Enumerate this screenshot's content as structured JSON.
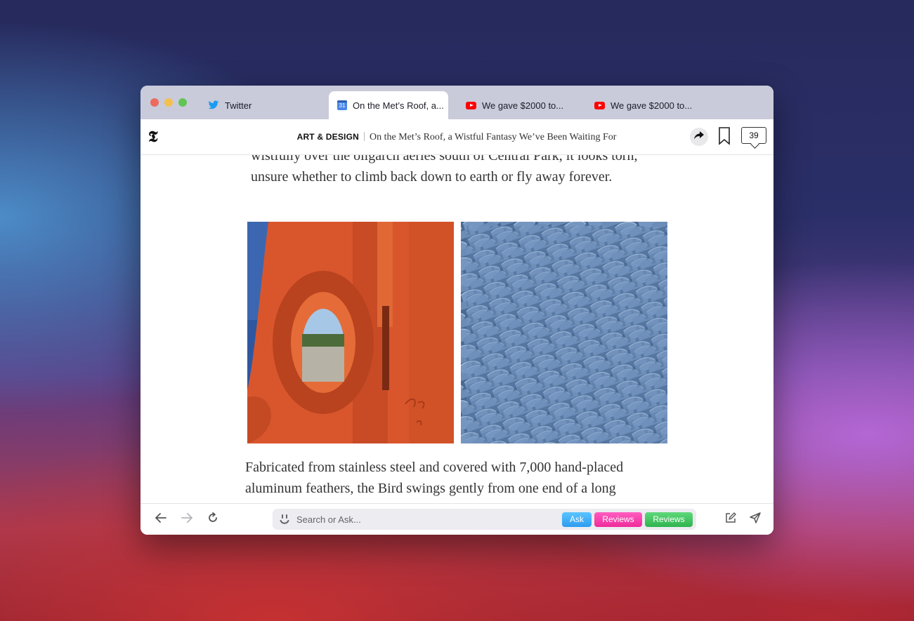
{
  "tabs": [
    {
      "label": "Twitter",
      "icon": "twitter-icon"
    },
    {
      "label": "On the Met’s Roof, a...",
      "icon": "calendar-icon",
      "active": true
    },
    {
      "label": "We gave $2000 to...",
      "icon": "youtube-icon"
    },
    {
      "label": "We gave $2000 to...",
      "icon": "youtube-icon"
    }
  ],
  "header": {
    "logo": "𝕿",
    "section": "ART & DESIGN",
    "title": "On the Met’s Roof, a Wistful Fantasy We’ve Been Waiting For",
    "comment_count": "39"
  },
  "article": {
    "para1": "wistfully over the oligarch aeries south of Central Park, it looks torn, unsure whether to climb back down to earth or fly away forever.",
    "para2": "Fabricated from stainless steel and covered with 7,000 hand-placed aluminum feathers, the Bird swings gently from one end of a long"
  },
  "toolbar": {
    "search_placeholder": "Search or Ask...",
    "ask_label": "Ask",
    "reviews_label_1": "Reviews",
    "reviews_label_2": "Reviews"
  },
  "colors": {
    "tabbar": "#c9cbda",
    "ask_pill": "#2d9cf0",
    "reviews_pill_1": "#ef2a9b",
    "reviews_pill_2": "#2fb34f"
  }
}
